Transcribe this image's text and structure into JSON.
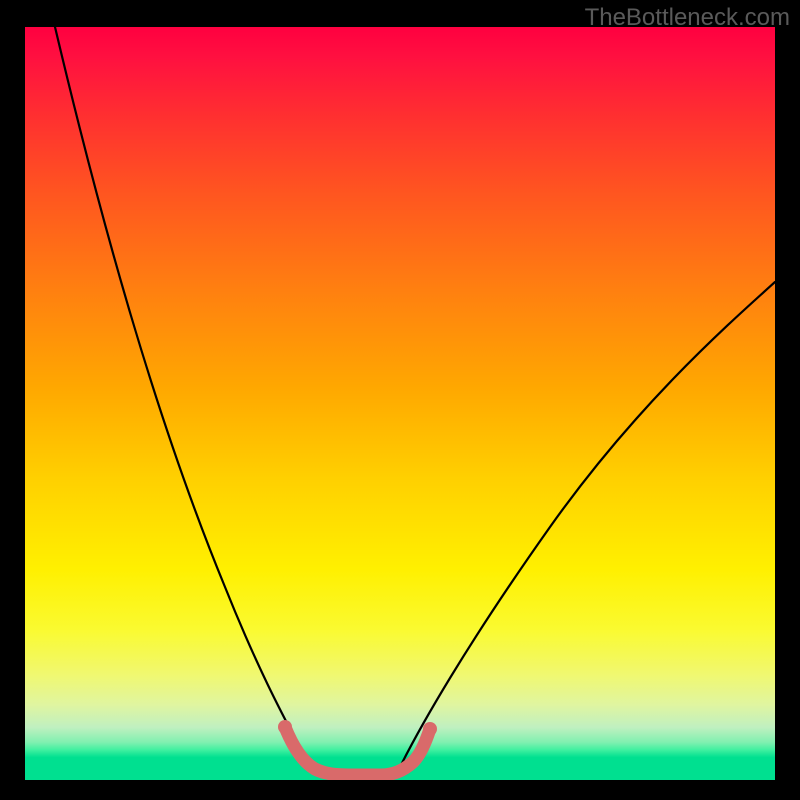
{
  "watermark": "TheBottleneck.com",
  "chart_data": {
    "type": "line",
    "title": "",
    "xlabel": "",
    "ylabel": "",
    "xlim": [
      0,
      100
    ],
    "ylim": [
      0,
      100
    ],
    "grid": false,
    "legend": false,
    "series": [
      {
        "name": "left-curve",
        "color": "#000000",
        "x": [
          4,
          10,
          16,
          22,
          26,
          30,
          34,
          38
        ],
        "y": [
          100,
          75,
          52,
          32,
          20,
          10,
          4,
          1
        ]
      },
      {
        "name": "right-curve",
        "color": "#000000",
        "x": [
          50,
          56,
          62,
          70,
          80,
          90,
          100
        ],
        "y": [
          1,
          4,
          10,
          22,
          40,
          55,
          66
        ]
      },
      {
        "name": "basin-segment",
        "color": "#d96a6a",
        "x": [
          35,
          37,
          39,
          41,
          43,
          47,
          49,
          51,
          53
        ],
        "y": [
          6,
          3,
          1.5,
          1,
          1,
          1,
          1.5,
          3,
          6
        ]
      }
    ],
    "background_gradient": {
      "top": "#ff0040",
      "mid": "#ffe600",
      "bottom": "#00e090"
    }
  }
}
